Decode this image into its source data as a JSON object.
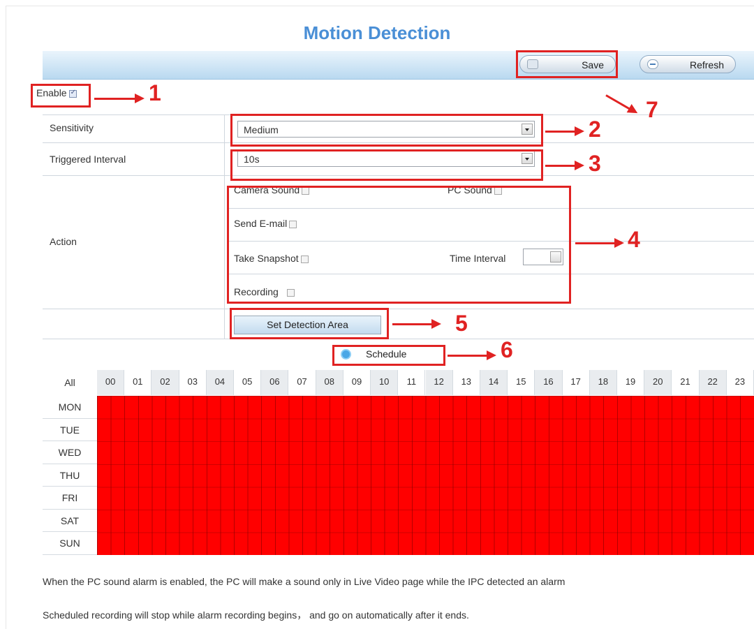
{
  "page": {
    "title": "Motion Detection"
  },
  "toolbar": {
    "save_label": "Save",
    "refresh_label": "Refresh"
  },
  "enable": {
    "label": "Enable",
    "checked": true
  },
  "settings": {
    "sensitivity_label": "Sensitivity",
    "sensitivity_value": "Medium",
    "interval_label": "Triggered Interval",
    "interval_value": "10s",
    "action_label": "Action",
    "camera_sound_label": "Camera Sound",
    "pc_sound_label": "PC Sound",
    "send_email_label": "Send E-mail",
    "take_snapshot_label": "Take Snapshot",
    "time_interval_label": "Time Interval",
    "time_interval_value": "",
    "recording_label": "Recording",
    "set_detection_area_label": "Set Detection Area"
  },
  "schedule": {
    "tab_label": "Schedule",
    "all_label": "All",
    "hours": [
      "00",
      "01",
      "02",
      "03",
      "04",
      "05",
      "06",
      "07",
      "08",
      "09",
      "10",
      "11",
      "12",
      "13",
      "14",
      "15",
      "16",
      "17",
      "18",
      "19",
      "20",
      "21",
      "22",
      "23"
    ],
    "days": [
      "MON",
      "TUE",
      "WED",
      "THU",
      "FRI",
      "SAT",
      "SUN"
    ],
    "all_selected": true,
    "selected_color": "#ff0000"
  },
  "annotations": [
    "1",
    "2",
    "3",
    "4",
    "5",
    "6",
    "7"
  ],
  "notes": [
    "When the PC sound alarm is enabled, the PC will make a sound only in Live Video page while the IPC detected an alarm",
    "Scheduled recording will stop while alarm recording begins， and go on automatically after it ends."
  ],
  "colors": {
    "title": "#4a8fd6",
    "annotation_red": "#e02222",
    "grid_red": "#ff0000"
  }
}
